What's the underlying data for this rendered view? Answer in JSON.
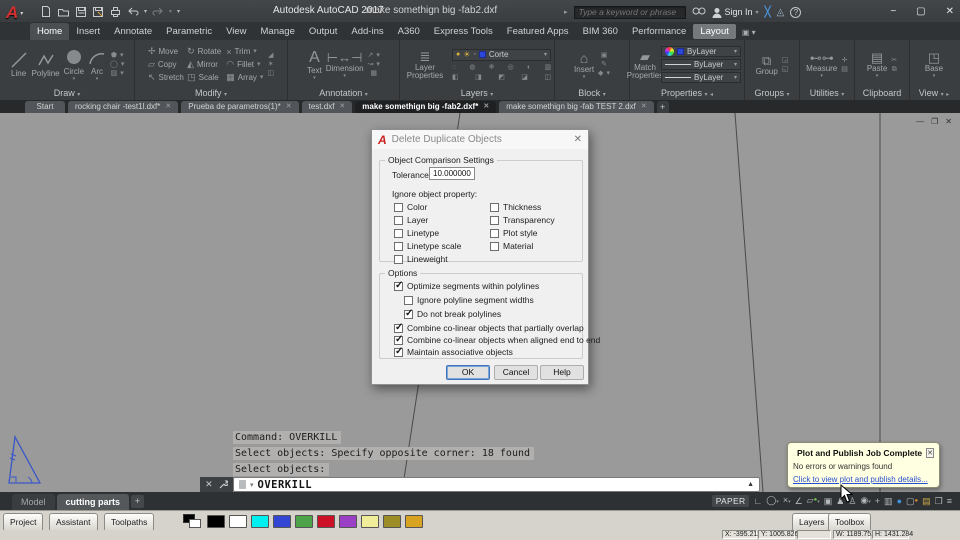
{
  "titlebar": {
    "app_title": "Autodesk AutoCAD 2017",
    "doc_title": "make somethign big -fab2.dxf",
    "search_placeholder": "Type a keyword or phrase",
    "sign_in_label": "Sign In",
    "minimize": "−",
    "maximize": "▢",
    "close": "✕"
  },
  "ribbon": {
    "tabs": [
      "Home",
      "Insert",
      "Annotate",
      "Parametric",
      "View",
      "Manage",
      "Output",
      "Add-ins",
      "A360",
      "Express Tools",
      "Featured Apps",
      "BIM 360",
      "Performance",
      "Layout"
    ],
    "draw": {
      "label": "Draw",
      "line": "Line",
      "polyline": "Polyline",
      "circle": "Circle",
      "arc": "Arc"
    },
    "modify": {
      "label": "Modify",
      "move": "Move",
      "rotate": "Rotate",
      "trim": "Trim",
      "copy": "Copy",
      "mirror": "Mirror",
      "fillet": "Fillet",
      "stretch": "Stretch",
      "scale": "Scale",
      "array": "Array"
    },
    "annotation": {
      "label": "Annotation",
      "text": "Text",
      "dimension": "Dimension"
    },
    "layers": {
      "label": "Layers",
      "layer_properties": "Layer Properties",
      "current_layer": "Corte"
    },
    "block": {
      "label": "Block",
      "insert": "Insert"
    },
    "properties": {
      "label": "Properties",
      "match": "Match Properties",
      "color_value": "ByLayer",
      "lineweight_value": "ByLayer",
      "linetype_value": "ByLayer"
    },
    "groups": {
      "label": "Groups",
      "group": "Group"
    },
    "utilities": {
      "label": "Utilities",
      "measure": "Measure"
    },
    "clipboard": {
      "label": "Clipboard",
      "paste": "Paste"
    },
    "view": {
      "label": "View",
      "base": "Base"
    }
  },
  "file_tabs": {
    "tabs": [
      "Start",
      "rocking chair -test1l.dxf*",
      "Prueba de parametros(1)*",
      "test.dxf",
      "make somethign big -fab2.dxf*",
      "make somethign big -fab TEST 2.dxf"
    ],
    "active_index": 4
  },
  "dialog": {
    "title": "Delete Duplicate Objects",
    "group_comparison": "Object Comparison Settings",
    "tolerance_label": "Tolerance",
    "tolerance_value": "10.000000",
    "ignore_label": "Ignore object property:",
    "prop_color": "Color",
    "prop_layer": "Layer",
    "prop_linetype": "Linetype",
    "prop_linetype_scale": "Linetype scale",
    "prop_lineweight": "Lineweight",
    "prop_thickness": "Thickness",
    "prop_transparency": "Transparency",
    "prop_plot_style": "Plot style",
    "prop_material": "Material",
    "prop_checked": {
      "color": false,
      "layer": false,
      "linetype": false,
      "linetype_scale": false,
      "lineweight": false,
      "thickness": false,
      "transparency": false,
      "plot_style": false,
      "material": false
    },
    "group_options": "Options",
    "opt1": "Optimize segments within polylines",
    "opt2": "Ignore polyline segment widths",
    "opt3": "Do not break polylines",
    "opt4": "Combine co-linear objects that partially overlap",
    "opt5": "Combine co-linear objects when aligned end to end",
    "opt6": "Maintain associative objects",
    "opt_checked": [
      true,
      false,
      true,
      true,
      true,
      true
    ],
    "ok_label": "OK",
    "cancel_label": "Cancel",
    "help_label": "Help"
  },
  "command": {
    "history": [
      "Command: OVERKILL",
      "Select objects: Specify opposite corner: 18 found",
      "Select objects:"
    ],
    "input_value": "OVERKILL"
  },
  "notification": {
    "title": "Plot and Publish Job Complete",
    "message": "No errors or warnings found",
    "link": "Click to view plot and publish details..."
  },
  "statusbar": {
    "model_tab": "Model",
    "layout_tab": "cutting parts",
    "paper_label": "PAPER"
  },
  "bottom_panel": {
    "tabs_left": [
      "Project",
      "Assistant",
      "Toolpaths"
    ],
    "tabs_right": [
      "Layers",
      "Toolbox"
    ],
    "swatches": [
      "#000000",
      "#ffffff",
      "#00f0f0",
      "#3346d3",
      "#4ea34a",
      "#cc1126",
      "#9b3fc4",
      "#efec9a",
      "#9d8d26",
      "#d8a321"
    ]
  },
  "coords": {
    "x": "X: -395.211",
    "y": "Y: 1005.826",
    "w": "W: 1189.751",
    "h": "H: 1431.284"
  }
}
